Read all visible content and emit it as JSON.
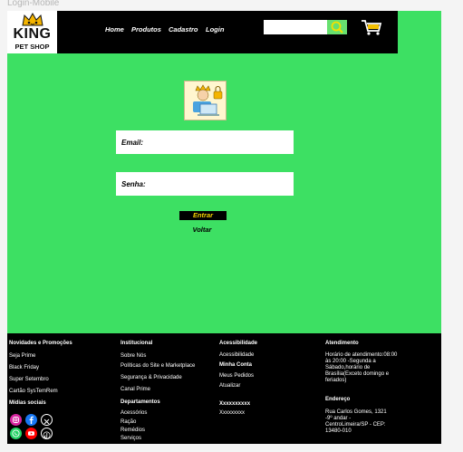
{
  "frame": {
    "title": "Login-Mobile"
  },
  "header": {
    "logo": {
      "brand": "KING",
      "sub": "PET SHOP"
    },
    "nav": [
      "Home",
      "Produtos",
      "Cadastro",
      "Login"
    ],
    "search": {
      "placeholder": ""
    }
  },
  "form": {
    "email_label": "Email:",
    "password_label": "Senha:",
    "submit_label": "Entrar",
    "back_label": "Voltar"
  },
  "footer": {
    "col1": {
      "heading": "Novidades e Promoções",
      "items": [
        "Seja Prime",
        "Black Friday",
        "Super Setembro",
        "Cartão SysTemRem"
      ],
      "social_heading": "Mídias sociais"
    },
    "col2": {
      "heading": "Institucional",
      "items": [
        "Sobre Nós",
        "Políticas do Site e Marketplace",
        "Segurança & Privacidade",
        "Canal Prime"
      ],
      "dept_heading": "Departamentos",
      "dept_items": [
        "Acessórios",
        "Ração",
        "Remédios",
        "Serviços"
      ]
    },
    "col3": {
      "heading": "Acessibilidade",
      "items": [
        "Acessibilidade"
      ],
      "account_heading": "Minha Conta",
      "account_items": [
        "Meus Pedidos",
        "Atualizar"
      ],
      "x_heading": "Xxxxxxxxxx",
      "x_items": [
        "Xxxxxxxxx"
      ]
    },
    "col4": {
      "heading": "Atendimento",
      "hours": "Horário de atendimento:08:00 às 20:00 -Segunda a Sábado,horário de Brasília(Exceto domingo e feriados)",
      "address_heading": "Endereço",
      "address": "Rua Carlos Gomes, 1321 -9º andar - CentroLimeira/SP - CEP: 13480-010"
    }
  },
  "colors": {
    "page_bg": "#3de063",
    "header_bg": "#000000",
    "accent_yellow": "#f1d000"
  }
}
